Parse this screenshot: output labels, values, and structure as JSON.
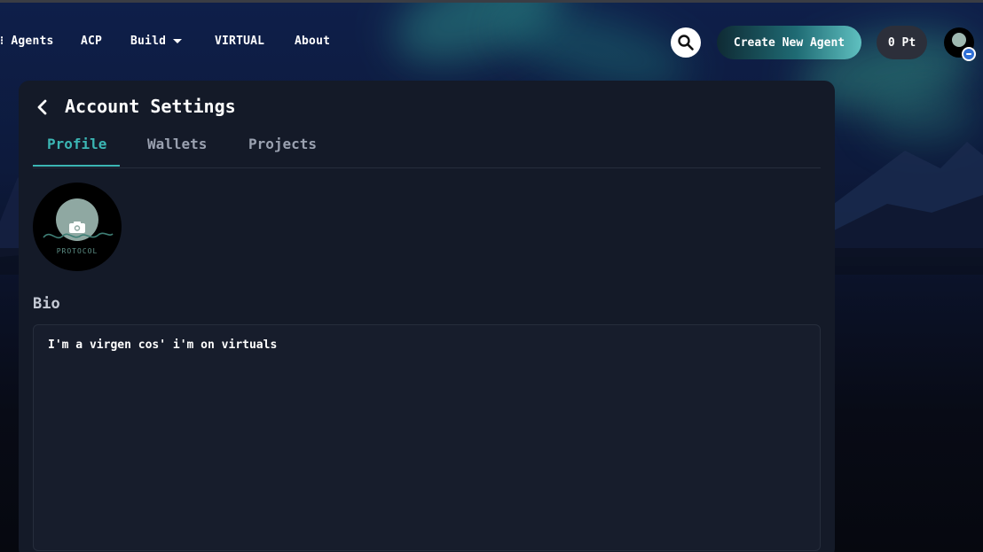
{
  "nav": {
    "items": [
      {
        "label": "Agents"
      },
      {
        "label": "ACP"
      },
      {
        "label": "Build"
      },
      {
        "label": "VIRTUAL"
      },
      {
        "label": "About"
      }
    ],
    "create_label": "Create New Agent",
    "points_label": "0 Pt"
  },
  "page": {
    "title": "Account Settings",
    "tabs": [
      {
        "label": "Profile",
        "active": true
      },
      {
        "label": "Wallets",
        "active": false
      },
      {
        "label": "Projects",
        "active": false
      }
    ]
  },
  "profile": {
    "avatar_caption": "PROTOCOL",
    "bio_label": "Bio",
    "bio_value": "I'm a virgen cos' i'm on virtuals"
  },
  "colors": {
    "accent": "#3bb6b4",
    "card": "#141a28"
  },
  "icons": {
    "back": "chevron-left-icon",
    "search": "search-icon",
    "build_dropdown": "caret-down-icon",
    "camera": "camera-icon"
  }
}
